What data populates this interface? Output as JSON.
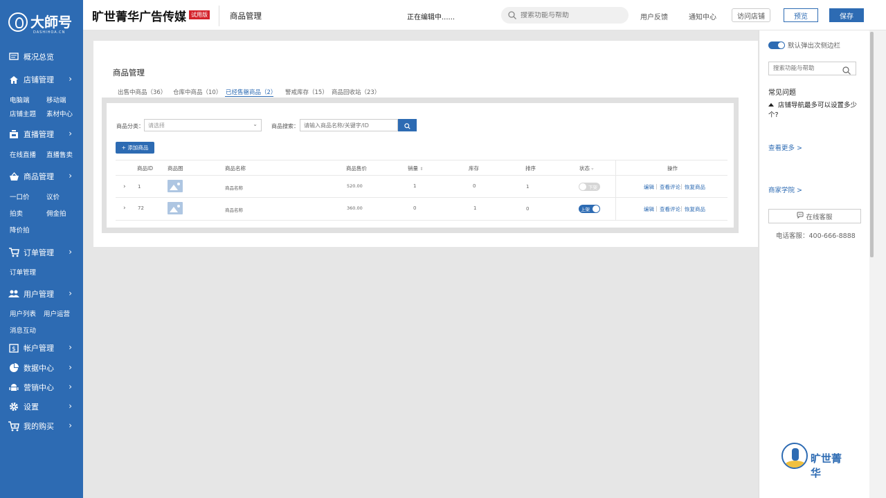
{
  "sidebar": {
    "logo_text": "大師号",
    "logo_sub": "DASHIHOA.CN",
    "items": [
      {
        "label": "概况总览",
        "icon": "overview-icon",
        "subs": []
      },
      {
        "label": "店铺管理",
        "icon": "home-icon",
        "subs": [
          "电脑端",
          "移动端",
          "店铺主题",
          "素材中心"
        ]
      },
      {
        "label": "直播管理",
        "icon": "live-icon",
        "subs": [
          "在线直播",
          "直播售卖"
        ]
      },
      {
        "label": "商品管理",
        "icon": "basket-icon",
        "subs": [
          "一口价",
          "议价",
          "拍卖",
          "佣金拍",
          "降价拍"
        ]
      },
      {
        "label": "订单管理",
        "icon": "cart-icon",
        "subs": [
          "订单管理"
        ]
      },
      {
        "label": "用户管理",
        "icon": "users-icon",
        "subs": [
          "用户列表",
          "用户运营",
          "消息互动"
        ]
      },
      {
        "label": "帐户管理",
        "icon": "account-icon",
        "subs": []
      },
      {
        "label": "数据中心",
        "icon": "pie-chart-icon",
        "subs": []
      },
      {
        "label": "营销中心",
        "icon": "android-icon",
        "subs": []
      },
      {
        "label": "设置",
        "icon": "gear-icon",
        "subs": []
      },
      {
        "label": "我的购买",
        "icon": "purchase-cart-icon",
        "subs": []
      }
    ]
  },
  "topbar": {
    "brand": "旷世菁华广告传媒",
    "trial": "试用版",
    "crumb": "商品管理",
    "editing": "正在编辑中......",
    "search_placeholder": "搜索功能与帮助",
    "feedback": "用户反馈",
    "notifications": "通知中心",
    "visit_store": "访问店铺",
    "preview": "预览",
    "save": "保存"
  },
  "main": {
    "title": "商品管理",
    "tabs": [
      "出售中商品（36）",
      "仓库中商品（10）",
      "已经售罄商品（2）",
      "警戒库存（15）",
      "商品回收站（23）"
    ],
    "active_tab": 2,
    "filter": {
      "category_label": "商品分类：",
      "category_placeholder": "请选择",
      "search_label": "商品搜索：",
      "search_placeholder": "请输入商品名称/关键字/ID"
    },
    "add_button": "+ 添加商品",
    "columns": [
      "商品ID",
      "商品图",
      "商品名称",
      "商品售价",
      "销量",
      "库存",
      "排序",
      "状态",
      "操作"
    ],
    "rows": [
      {
        "id": "1",
        "name": "商品名称",
        "price": "520.00",
        "sales": "1",
        "stock": "0",
        "sort": "1",
        "status": "下架",
        "status_on": false
      },
      {
        "id": "72",
        "name": "商品名称",
        "price": "360.00",
        "sales": "0",
        "stock": "1",
        "sort": "0",
        "status": "上架",
        "status_on": true
      }
    ],
    "ops": [
      "编辑",
      "查看评论",
      "恢复商品"
    ]
  },
  "rightbar": {
    "toggle_label": "默认弹出次侧边栏",
    "search_placeholder": "搜索功能与帮助",
    "faq_title": "常见问题",
    "faq_item": "店铺导航最多可以设置多少个?",
    "see_more": "查看更多 >",
    "academy": "商家学院 >",
    "online_service": "在线客服",
    "hotline": "电话客服：400-666-8888",
    "logo_name": "旷世菁华"
  }
}
